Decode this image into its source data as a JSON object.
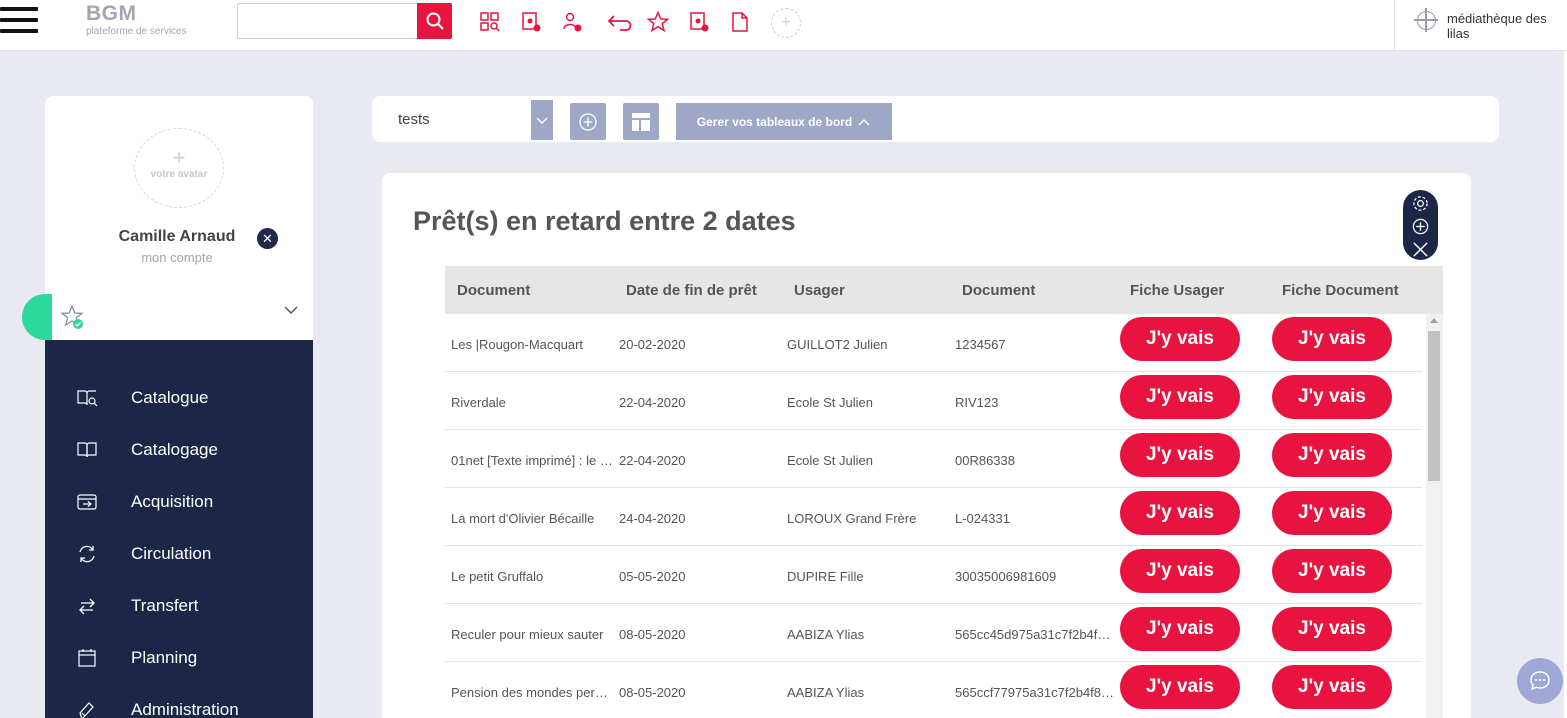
{
  "brand": {
    "name": "BGM",
    "tagline": "plateforme de services"
  },
  "search": {
    "value": "",
    "placeholder": ""
  },
  "toolbar_icons": [
    "catalog-search-icon",
    "document-add-icon",
    "user-add-icon",
    "undo-icon",
    "star-icon",
    "document-remove-icon",
    "page-icon",
    "add-shortcut-icon"
  ],
  "library": {
    "name": "médiathèque des lilas"
  },
  "profile": {
    "avatar_label": "votre avatar",
    "avatar_plus": "+",
    "name": "Camille Arnaud",
    "account_link": "mon compte"
  },
  "nav": {
    "items": [
      {
        "label": "Catalogue",
        "icon": "book-search-icon"
      },
      {
        "label": "Catalogage",
        "icon": "open-book-icon"
      },
      {
        "label": "Acquisition",
        "icon": "inbox-arrow-icon"
      },
      {
        "label": "Circulation",
        "icon": "refresh-icon"
      },
      {
        "label": "Transfert",
        "icon": "transfer-icon"
      },
      {
        "label": "Planning",
        "icon": "calendar-icon"
      },
      {
        "label": "Administration",
        "icon": "pen-icon"
      }
    ]
  },
  "dashboard": {
    "selected": "tests",
    "manage_label": "Gerer vos tableaux de bord"
  },
  "widget": {
    "title": "Prêt(s) en retard entre 2 dates",
    "columns": [
      "Document",
      "Date de fin de prêt",
      "Usager",
      "Document",
      "Fiche Usager",
      "Fiche Document"
    ],
    "button_label": "J'y vais",
    "rows": [
      {
        "document": "Les |Rougon-Macquart",
        "date": "20-02-2020",
        "user": "GUILLOT2 Julien",
        "code": "1234567"
      },
      {
        "document": "Riverdale",
        "date": "22-04-2020",
        "user": "Ecole St Julien",
        "code": "RIV123"
      },
      {
        "document": "01net [Texte imprimé] : le …",
        "date": "22-04-2020",
        "user": "Ecole St Julien",
        "code": "00R86338"
      },
      {
        "document": "La mort d'Olivier Bécaille",
        "date": "24-04-2020",
        "user": "LOROUX Grand Frère",
        "code": "L-024331"
      },
      {
        "document": "Le petit Gruffalo",
        "date": "05-05-2020",
        "user": "DUPIRE Fille",
        "code": "30035006981609"
      },
      {
        "document": "Reculer pour mieux sauter",
        "date": "08-05-2020",
        "user": "AABIZA Ylias",
        "code": "565cc45d975a31c7f2b4f8…"
      },
      {
        "document": "Pension des mondes per…",
        "date": "08-05-2020",
        "user": "AABIZA Ylias",
        "code": "565ccf77975a31c7f2b4f8…"
      }
    ]
  },
  "colors": {
    "accent": "#e8133f",
    "nav_bg": "#1c2748",
    "green": "#2dd89c",
    "muted_blue": "#9ea7c6"
  }
}
